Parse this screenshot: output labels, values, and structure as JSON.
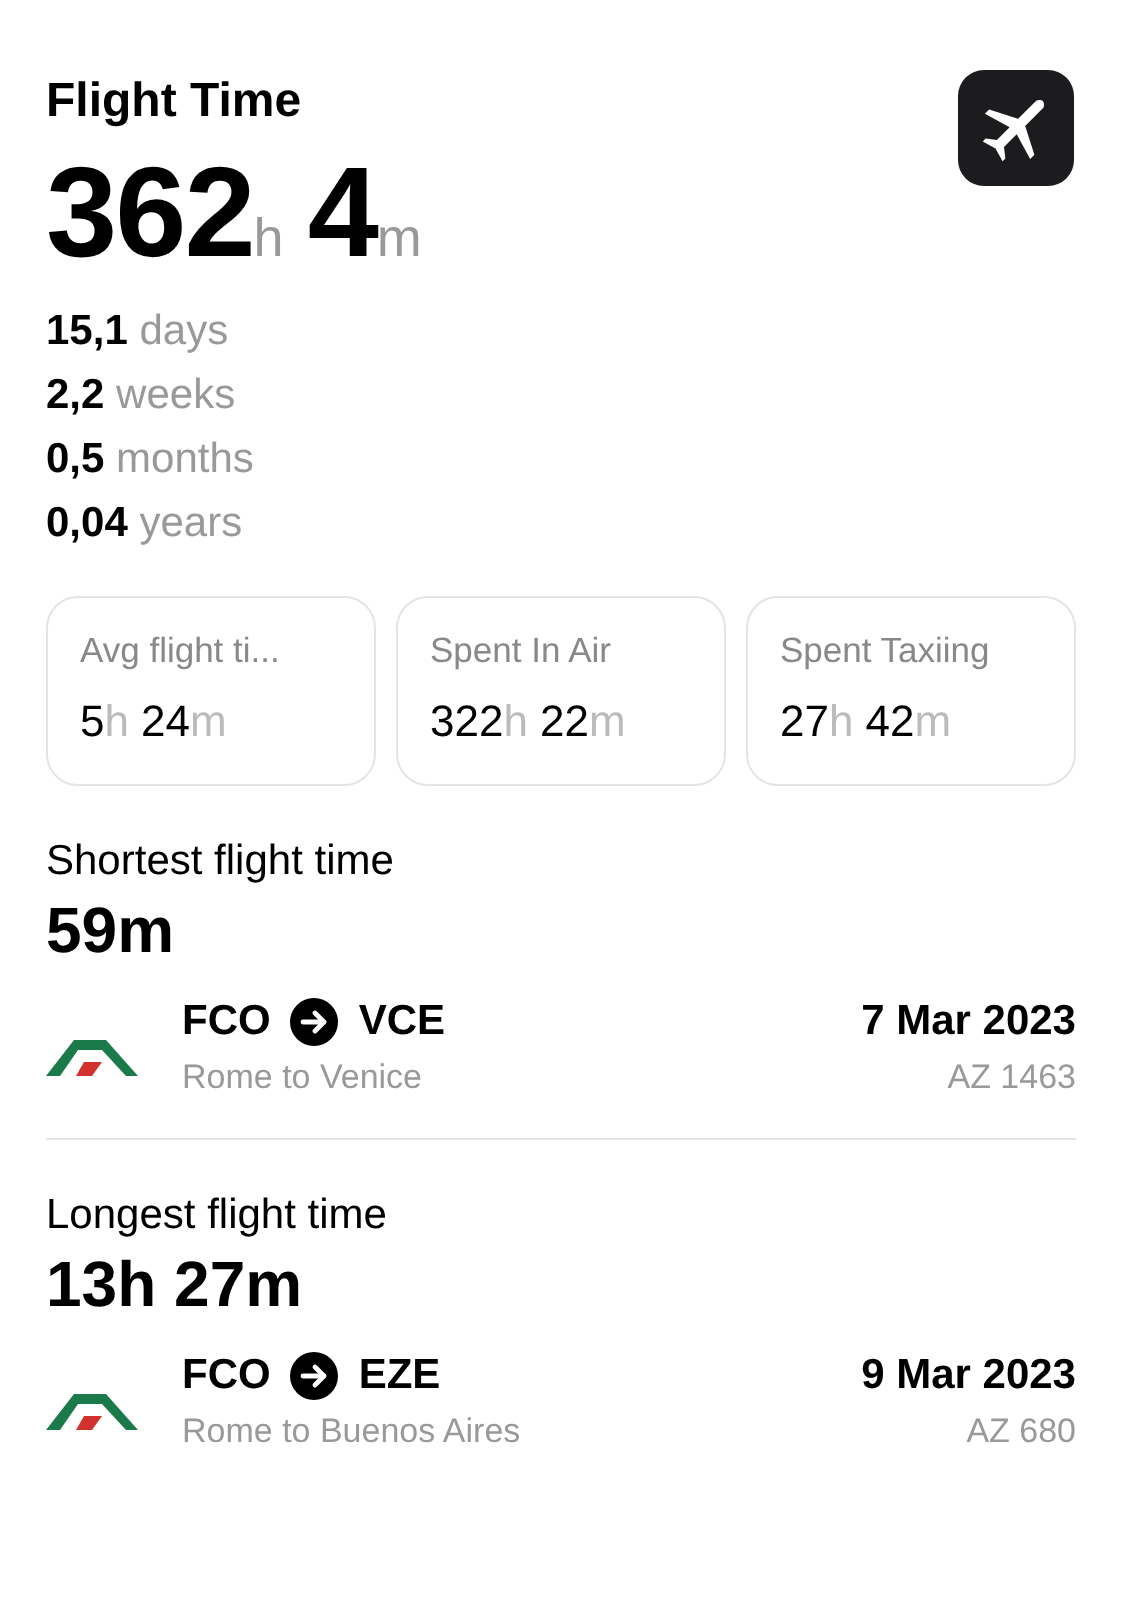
{
  "header": {
    "title": "Flight Time",
    "total": [
      {
        "value": "362",
        "unit": "h"
      },
      {
        "value": "4",
        "unit": "m"
      }
    ]
  },
  "breakdown": [
    {
      "value": "15,1",
      "unit": "days"
    },
    {
      "value": "2,2",
      "unit": "weeks"
    },
    {
      "value": "0,5",
      "unit": "months"
    },
    {
      "value": "0,04",
      "unit": "years"
    }
  ],
  "cards": [
    {
      "label": "Avg flight ti...",
      "parts": [
        {
          "value": "5",
          "unit": "h"
        },
        {
          "value": "24",
          "unit": "m"
        }
      ]
    },
    {
      "label": "Spent In Air",
      "parts": [
        {
          "value": "322",
          "unit": "h"
        },
        {
          "value": "22",
          "unit": "m"
        }
      ]
    },
    {
      "label": "Spent Taxiing",
      "parts": [
        {
          "value": "27",
          "unit": "h"
        },
        {
          "value": "42",
          "unit": "m"
        }
      ]
    }
  ],
  "records": [
    {
      "title": "Shortest flight time",
      "duration": "59m",
      "flight": {
        "from": "FCO",
        "to": "VCE",
        "route": "Rome to Venice",
        "date": "7 Mar 2023",
        "number": "AZ 1463"
      }
    },
    {
      "title": "Longest flight time",
      "duration": "13h 27m",
      "flight": {
        "from": "FCO",
        "to": "EZE",
        "route": "Rome to Buenos Aires",
        "date": "9 Mar 2023",
        "number": "AZ 680"
      }
    }
  ]
}
